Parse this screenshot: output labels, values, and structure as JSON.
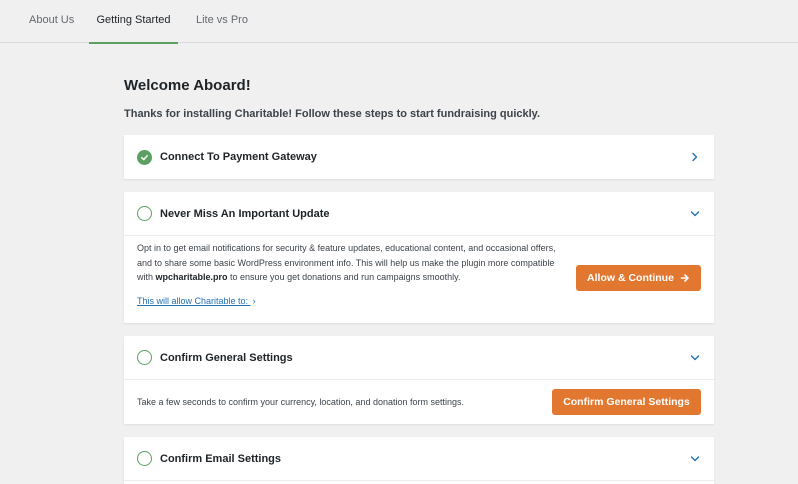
{
  "tabs": [
    {
      "label": "About Us",
      "active": false
    },
    {
      "label": "Getting Started",
      "active": true
    },
    {
      "label": "Lite vs Pro",
      "active": false
    }
  ],
  "welcome": {
    "title": "Welcome Aboard!",
    "subtitle": "Thanks for installing Charitable! Follow these steps to start fundraising quickly."
  },
  "steps": [
    {
      "title": "Connect To Payment Gateway",
      "status": "completed",
      "expanded": false
    },
    {
      "title": "Never Miss An Important Update",
      "status": "pending",
      "expanded": true,
      "body_part1": "Opt in to get email notifications for security & feature updates, educational content, and occasional offers, and to share some basic WordPress environment info. This will help us make the plugin more compatible with ",
      "body_bold": "wpcharitable.pro",
      "body_part2": " to ensure you get donations and run campaigns smoothly.",
      "link_label": "This will allow Charitable to:",
      "link_arrow": "›",
      "button_label": "Allow & Continue"
    },
    {
      "title": "Confirm General Settings",
      "status": "pending",
      "expanded": true,
      "body": "Take a few seconds to confirm your currency, location, and donation form settings.",
      "button_label": "Confirm General Settings"
    },
    {
      "title": "Confirm Email Settings",
      "status": "pending",
      "expanded": true
    }
  ],
  "colors": {
    "accent_green": "#5c9f63",
    "button_orange": "#e27730",
    "link_blue": "#2271b1",
    "page_bg": "#f0f0f1"
  },
  "icons": {
    "completed": "check-circle-icon",
    "pending": "empty-circle-icon",
    "collapsed": "chevron-right-icon",
    "expanded": "chevron-down-icon",
    "button_arrow": "arrow-right-icon"
  }
}
